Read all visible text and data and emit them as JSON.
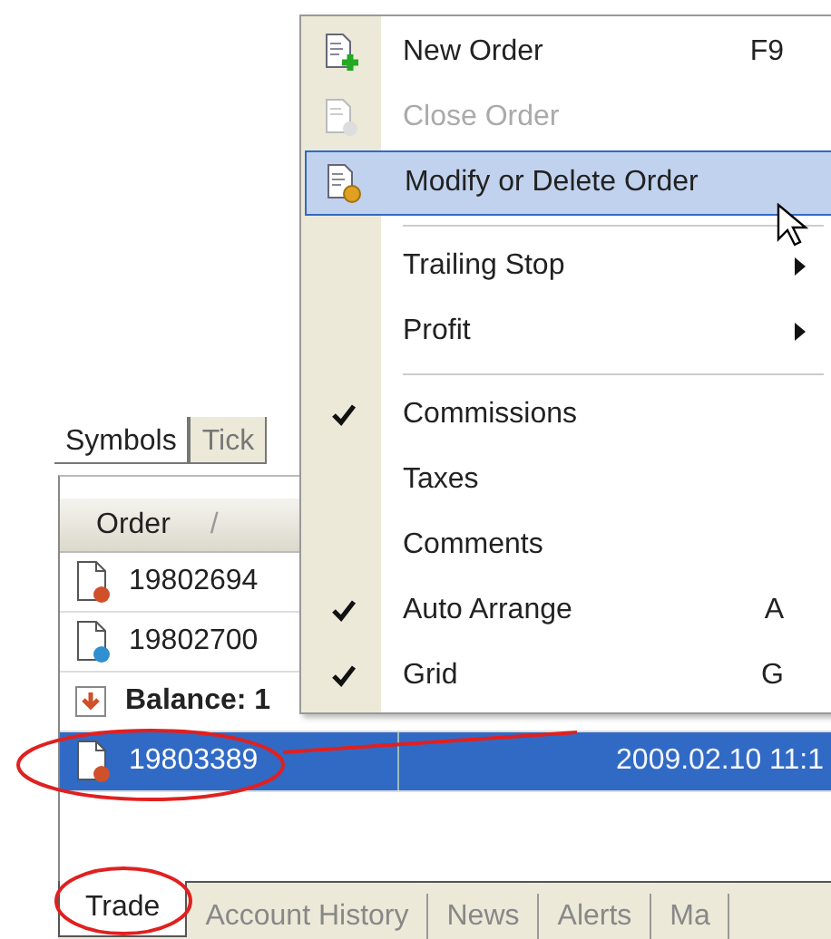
{
  "top_tabs": [
    {
      "label": "Symbols",
      "selected": true
    },
    {
      "label": "Tick",
      "selected": false
    }
  ],
  "columns": [
    {
      "label": "Order",
      "sort": "/"
    }
  ],
  "rows": [
    {
      "kind": "order",
      "color": "#d0502a",
      "order": "19802694",
      "selected": false
    },
    {
      "kind": "order",
      "color": "#2f8fd0",
      "order": "19802700",
      "selected": false
    },
    {
      "kind": "balance",
      "order": "Balance: 1",
      "selected": false
    },
    {
      "kind": "order",
      "color": "#d0502a",
      "order": "19803389",
      "time": "2009.02.10 11:1",
      "selected": true
    }
  ],
  "context_menu": {
    "items": [
      {
        "kind": "item",
        "label": "New Order",
        "shortcut": "F9",
        "disabled": false,
        "selected": false
      },
      {
        "kind": "item",
        "label": "Close Order",
        "disabled": true,
        "selected": false
      },
      {
        "kind": "item",
        "label": "Modify or Delete Order",
        "disabled": false,
        "selected": true
      },
      {
        "kind": "separator"
      },
      {
        "kind": "item",
        "label": "Trailing Stop",
        "submenu": true,
        "disabled": false,
        "selected": false
      },
      {
        "kind": "item",
        "label": "Profit",
        "submenu": true,
        "disabled": false,
        "selected": false
      },
      {
        "kind": "separator"
      },
      {
        "kind": "item",
        "label": "Commissions",
        "checked": true,
        "disabled": false,
        "selected": false
      },
      {
        "kind": "item",
        "label": "Taxes",
        "checked": false,
        "disabled": false,
        "selected": false
      },
      {
        "kind": "item",
        "label": "Comments",
        "checked": false,
        "disabled": false,
        "selected": false
      },
      {
        "kind": "item",
        "label": "Auto Arrange",
        "shortcut": "A",
        "checked": true,
        "disabled": false,
        "selected": false
      },
      {
        "kind": "item",
        "label": "Grid",
        "shortcut": "G",
        "checked": true,
        "disabled": false,
        "selected": false
      }
    ]
  },
  "bottom_tabs": [
    {
      "label": "Trade",
      "selected": true
    },
    {
      "label": "Account History",
      "selected": false
    },
    {
      "label": "News",
      "selected": false
    },
    {
      "label": "Alerts",
      "selected": false
    },
    {
      "label": "Ma",
      "selected": false
    }
  ]
}
